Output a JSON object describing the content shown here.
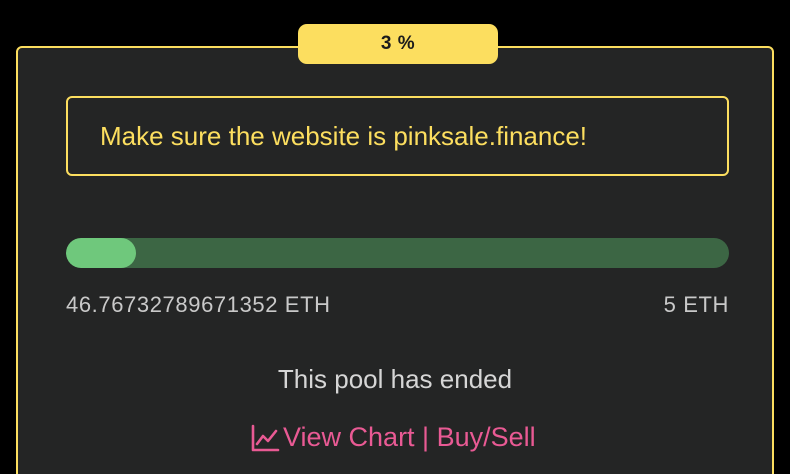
{
  "badge": {
    "label": "3 %"
  },
  "warning": {
    "text": "Make sure the website is pinksale.finance!"
  },
  "progress": {
    "fill_fraction": 0.106,
    "raised_label": "46.76732789671352 ETH",
    "target_label": "5 ETH"
  },
  "status": {
    "text": "This pool has ended"
  },
  "chart_link": {
    "label": "View Chart | Buy/Sell",
    "icon": "line-chart-icon"
  },
  "colors": {
    "accent_yellow": "#fcde5f",
    "card_bg": "#242525",
    "progress_track": "#3c6644",
    "progress_fill": "#6fc87c",
    "link_pink": "#e95a94"
  }
}
